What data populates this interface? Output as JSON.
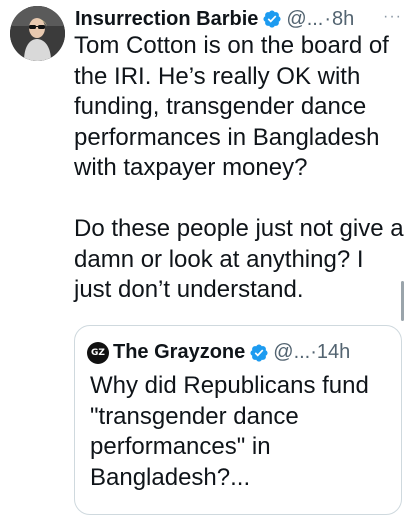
{
  "tweet": {
    "author": {
      "display_name": "Insurrection Barbie",
      "handle": "@...",
      "verified_icon": "verified-badge-icon",
      "avatar_icon": "profile-avatar"
    },
    "separator": "·",
    "time": "8h",
    "more_label": "···",
    "paragraphs": [
      "Tom Cotton is on the board of the IRI. He’s really OK with funding, transgender dance performances in Bangladesh with taxpayer money?",
      "Do these people just not give a damn or look at anything? I just don’t understand."
    ]
  },
  "quoted_tweet": {
    "author": {
      "display_name": "The Grayzone",
      "handle": "@...",
      "avatar_text": "GZ",
      "verified_icon": "verified-badge-icon"
    },
    "separator": "·",
    "time": "14h",
    "text": "Why did Republicans fund \"transgender dance performances\" in Bangladesh?..."
  },
  "colors": {
    "text_primary": "#0f1419",
    "text_secondary": "#536471",
    "verified_blue": "#1d9bf0",
    "border": "#cfd9de"
  }
}
